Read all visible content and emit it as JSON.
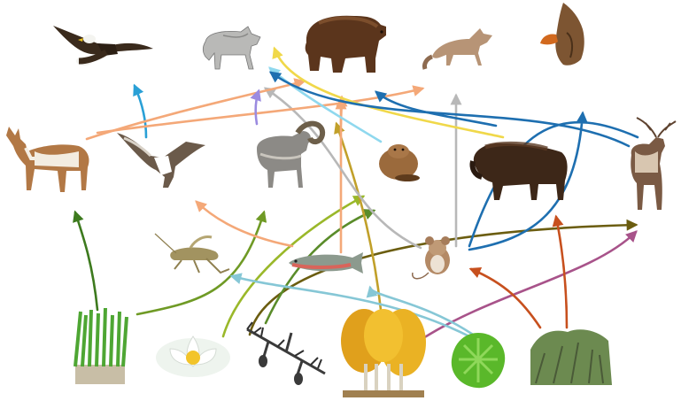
{
  "organisms": [
    {
      "id": "bald-eagle",
      "kind": "animal",
      "level": "top"
    },
    {
      "id": "gray-wolf",
      "kind": "animal",
      "level": "top"
    },
    {
      "id": "grizzly-bear",
      "kind": "animal",
      "level": "top"
    },
    {
      "id": "coyote",
      "kind": "animal",
      "level": "top"
    },
    {
      "id": "red-tailed-hawk",
      "kind": "animal",
      "level": "top"
    },
    {
      "id": "pronghorn",
      "kind": "animal",
      "level": "middle"
    },
    {
      "id": "osprey",
      "kind": "animal",
      "level": "middle"
    },
    {
      "id": "bighorn-sheep",
      "kind": "animal",
      "level": "middle"
    },
    {
      "id": "beaver",
      "kind": "animal",
      "level": "middle"
    },
    {
      "id": "bison",
      "kind": "animal",
      "level": "middle"
    },
    {
      "id": "elk",
      "kind": "animal",
      "level": "middle"
    },
    {
      "id": "grasshopper",
      "kind": "animal",
      "level": "lower"
    },
    {
      "id": "cutthroat-trout",
      "kind": "animal",
      "level": "lower"
    },
    {
      "id": "deer-mouse",
      "kind": "animal",
      "level": "lower"
    },
    {
      "id": "grass",
      "kind": "plant",
      "level": "producer"
    },
    {
      "id": "water-lily",
      "kind": "plant",
      "level": "producer"
    },
    {
      "id": "pine-branch",
      "kind": "plant",
      "level": "producer"
    },
    {
      "id": "aspen-trees",
      "kind": "plant",
      "level": "producer"
    },
    {
      "id": "algae",
      "kind": "plant",
      "level": "producer"
    },
    {
      "id": "shrubs",
      "kind": "plant",
      "level": "producer"
    }
  ],
  "links": [
    {
      "from": "grass",
      "to": "pronghorn",
      "color": "#3d7a1e"
    },
    {
      "from": "grass",
      "to": "bighorn-sheep",
      "color": "#6f9a25"
    },
    {
      "from": "water-lily",
      "to": "bighorn-sheep",
      "color": "#9ab82a"
    },
    {
      "from": "water-lily",
      "to": "elk",
      "color": "#6b5d10"
    },
    {
      "from": "pine-branch",
      "to": "bighorn-sheep",
      "color": "#5a8c2a"
    },
    {
      "from": "aspen-trees",
      "to": "beaver",
      "color": "#c1a02a"
    },
    {
      "from": "aspen-trees",
      "to": "elk",
      "color": "#a8538a"
    },
    {
      "from": "algae",
      "to": "cutthroat-trout",
      "color": "#86c7d6"
    },
    {
      "from": "algae",
      "to": "grasshopper",
      "color": "#86c7d6"
    },
    {
      "from": "shrubs",
      "to": "deer-mouse",
      "color": "#c7501e"
    },
    {
      "from": "shrubs",
      "to": "elk",
      "color": "#c7501e"
    },
    {
      "from": "grasshopper",
      "to": "osprey",
      "color": "#f4a878"
    },
    {
      "from": "cutthroat-trout",
      "to": "osprey",
      "color": "#f4a878"
    },
    {
      "from": "cutthroat-trout",
      "to": "grizzly-bear",
      "color": "#f4a878"
    },
    {
      "from": "deer-mouse",
      "to": "coyote",
      "color": "#b8b8b8"
    },
    {
      "from": "deer-mouse",
      "to": "gray-wolf",
      "color": "#b8b8b8"
    },
    {
      "from": "osprey",
      "to": "bald-eagle",
      "color": "#2aa0d6"
    },
    {
      "from": "pronghorn",
      "to": "grizzly-bear",
      "color": "#f4a878"
    },
    {
      "from": "pronghorn",
      "to": "coyote",
      "color": "#f4a878"
    },
    {
      "from": "bighorn-sheep",
      "to": "gray-wolf",
      "color": "#9b8be0"
    },
    {
      "from": "beaver",
      "to": "gray-wolf",
      "color": "#8fd8ee"
    },
    {
      "from": "bison",
      "to": "gray-wolf",
      "color": "#f0d84a"
    },
    {
      "from": "bison",
      "to": "grizzly-bear",
      "color": "#1e6fb0"
    },
    {
      "from": "elk",
      "to": "gray-wolf",
      "color": "#1e6fb0"
    },
    {
      "from": "elk",
      "to": "grizzly-bear",
      "color": "#1e6fb0"
    }
  ]
}
